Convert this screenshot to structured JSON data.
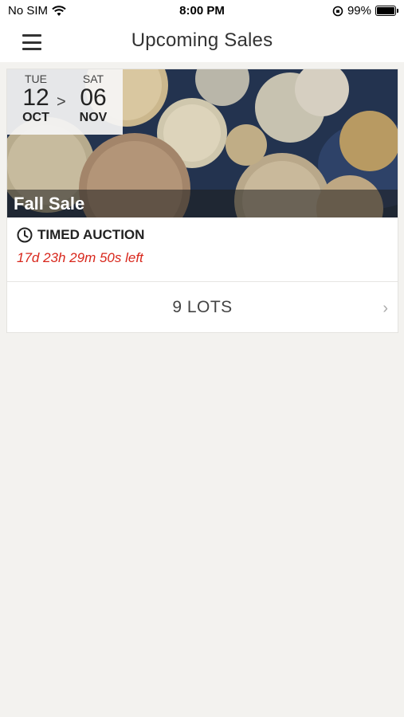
{
  "status_bar": {
    "carrier": "No SIM",
    "time": "8:00 PM",
    "battery_pct": "99%",
    "battery_level": 0.99
  },
  "nav": {
    "title": "Upcoming Sales",
    "menu_icon": "hamburger-icon"
  },
  "sale": {
    "start": {
      "dow": "TUE",
      "day": "12",
      "month": "OCT"
    },
    "arrow": ">",
    "end": {
      "dow": "SAT",
      "day": "06",
      "month": "NOV"
    },
    "title": "Fall Sale",
    "auction_type": "TIMED AUCTION",
    "countdown": "17d 23h 29m 50s left",
    "lots_label": "9 LOTS",
    "chevron": "›",
    "countdown_color": "#d8271c"
  }
}
